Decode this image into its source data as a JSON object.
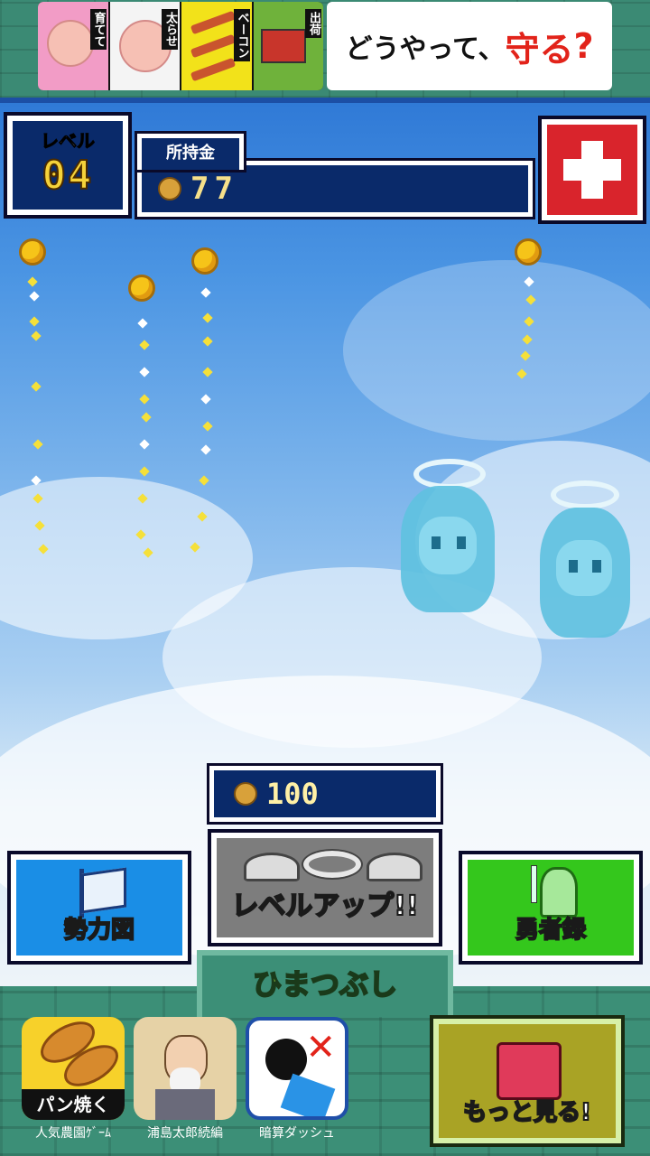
{
  "ad": {
    "left_panels": [
      "育てて",
      "太らせ",
      "ベーコン",
      "出荷"
    ],
    "right_text_a": "どうやって、",
    "right_text_b": "守る",
    "right_text_c": "?"
  },
  "hud": {
    "level_label": "レベル",
    "level_value": "04",
    "money_label": "所持金",
    "money_value": "77"
  },
  "levelup": {
    "cost": "100",
    "label": "レベルアップ!!"
  },
  "buttons": {
    "map_label": "勢力図",
    "hero_label": "勇者録"
  },
  "footer": {
    "title": "ひまつぶし",
    "apps": [
      {
        "banner": "パン焼く",
        "name": "人気農園ｹﾞｰﾑ"
      },
      {
        "name": "浦島太郎続編"
      },
      {
        "name": "暗算ダッシュ"
      }
    ],
    "more_label": "もっと見る!"
  },
  "colors": {
    "accent_red": "#d9242c",
    "panel_navy": "#0a2a6a",
    "map_blue": "#1a8ee6",
    "hero_green": "#34c71c",
    "title_green": "#b8f04a"
  }
}
